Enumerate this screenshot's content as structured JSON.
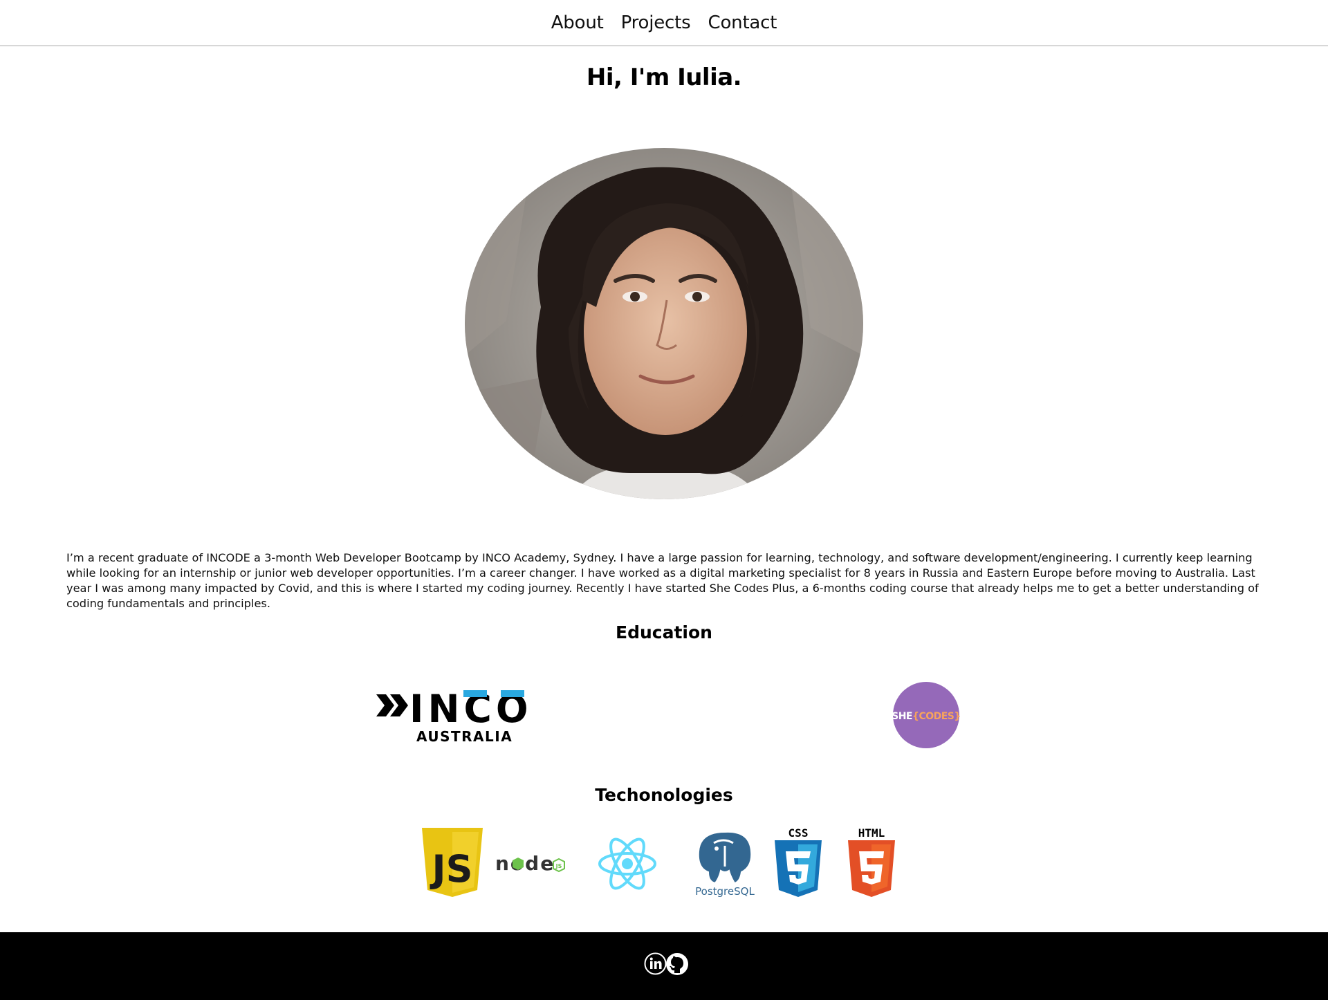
{
  "nav": {
    "links": [
      "About",
      "Projects",
      "Contact"
    ]
  },
  "hero": {
    "title": "Hi, I'm Iulia."
  },
  "bio": {
    "text": "I’m a recent graduate of INCODE a 3-month Web Developer Bootcamp by INCO Academy, Sydney. I have a large passion for learning, technology, and software development/engineering. I currently keep learning while looking for an internship or junior web developer opportunities. I’m a career changer. I have worked as a digital marketing specialist for 8 years in Russia and Eastern Europe before moving to Australia. Last year I was among many impacted by Covid, and this is where I started my coding journey. Recently I have started She Codes Plus, a 6-months coding course that already helps me to get a better understanding of coding fundamentals and principles."
  },
  "education": {
    "heading": "Education",
    "logos": [
      {
        "name": "inco-australia",
        "wordmark": "INCO",
        "subtitle": "AUSTRALIA",
        "accent_color": "#29a8e0"
      },
      {
        "name": "she-codes",
        "wordmark_left": "SHE",
        "wordmark_right": "{CODES}",
        "circle_color": "#9569b9",
        "accent_color": "#f7a35c"
      }
    ]
  },
  "technologies": {
    "heading": "Techonologies",
    "logos": [
      {
        "name": "javascript",
        "label": "JS",
        "color": "#e8c413"
      },
      {
        "name": "nodejs",
        "label": "node",
        "badge": "JS",
        "color": "#6cc24a"
      },
      {
        "name": "react",
        "color": "#61dafb"
      },
      {
        "name": "postgresql",
        "label": "PostgreSQL",
        "color": "#336791"
      },
      {
        "name": "css3",
        "label": "CSS",
        "color": "#1572b6"
      },
      {
        "name": "html5",
        "label": "HTML",
        "color": "#e34f26"
      }
    ]
  },
  "footer": {
    "icons": [
      "linkedin-icon",
      "github-icon"
    ]
  }
}
